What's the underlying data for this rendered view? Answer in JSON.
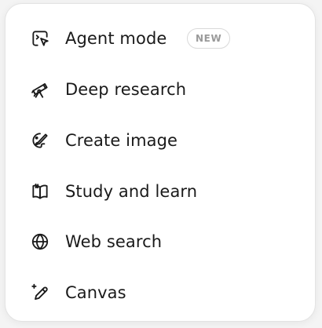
{
  "menu": {
    "items": [
      {
        "label": "Agent mode",
        "icon": "agent-cursor-icon",
        "badge": "NEW"
      },
      {
        "label": "Deep research",
        "icon": "telescope-icon"
      },
      {
        "label": "Create image",
        "icon": "palette-icon"
      },
      {
        "label": "Study and learn",
        "icon": "open-book-icon"
      },
      {
        "label": "Web search",
        "icon": "globe-icon"
      },
      {
        "label": "Canvas",
        "icon": "pencil-sparkle-icon"
      }
    ]
  },
  "colors": {
    "text": "#1a1a1a",
    "badge_text": "#9a9a9a",
    "badge_border": "#d9d9d9",
    "menu_background": "#ffffff",
    "page_background": "#f4f4f4"
  }
}
